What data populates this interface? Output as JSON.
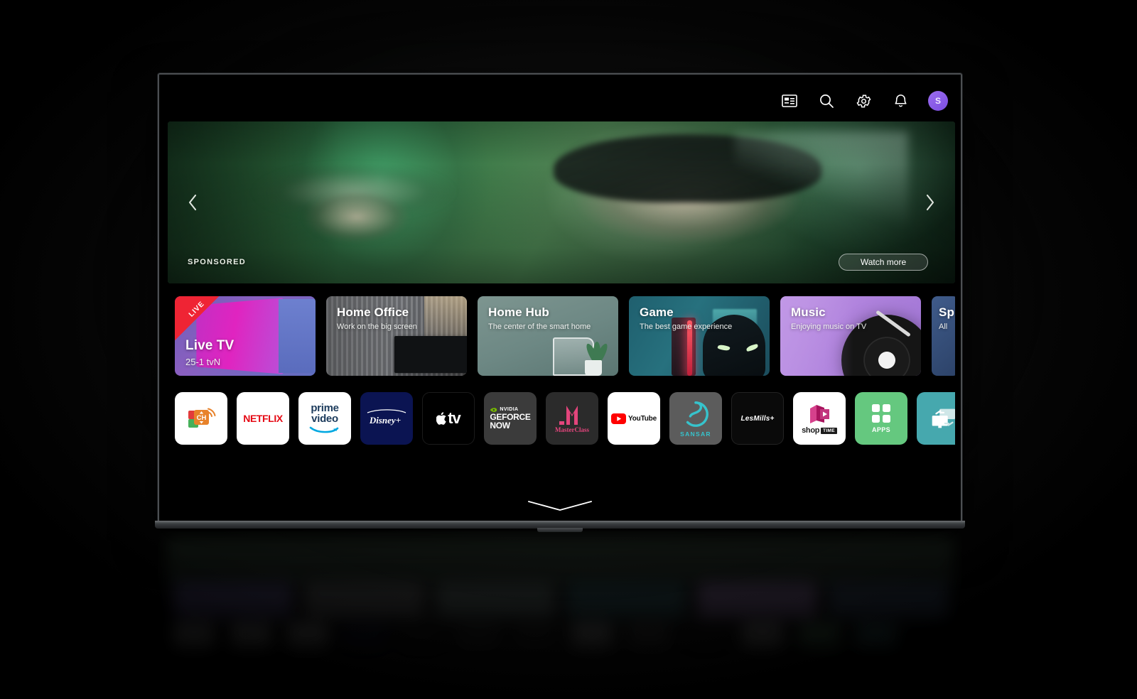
{
  "topbar": {
    "icons": [
      {
        "name": "inputs-dashboard-icon",
        "label": "Inputs"
      },
      {
        "name": "search-icon",
        "label": "Search"
      },
      {
        "name": "gear-icon",
        "label": "Settings"
      },
      {
        "name": "bell-icon",
        "label": "Notifications"
      }
    ],
    "avatar_initial": "S"
  },
  "hero": {
    "sponsored_label": "SPONSORED",
    "watch_more_label": "Watch more",
    "prev_arrow": "‹",
    "next_arrow": "›"
  },
  "cards": [
    {
      "title": "Live TV",
      "subtitle": "25-1  tvN",
      "badge": "LIVE"
    },
    {
      "title": "Home Office",
      "subtitle": "Work on the big screen",
      "badge": ""
    },
    {
      "title": "Home Hub",
      "subtitle": "The center of the smart home",
      "badge": ""
    },
    {
      "title": "Game",
      "subtitle": "The best game experience",
      "badge": ""
    },
    {
      "title": "Music",
      "subtitle": "Enjoying music on TV",
      "badge": ""
    },
    {
      "title": "Sp",
      "subtitle": "All",
      "badge": ""
    }
  ],
  "apps": [
    {
      "name": "channels",
      "label": "CH"
    },
    {
      "name": "netflix",
      "label": "NETFLIX"
    },
    {
      "name": "prime-video",
      "label_top": "prime",
      "label_bottom": "video"
    },
    {
      "name": "disney-plus",
      "label": "Disney+"
    },
    {
      "name": "apple-tv",
      "label": "tv"
    },
    {
      "name": "geforce-now",
      "brand": "NVIDIA",
      "line1": "GEFORCE",
      "line2": "NOW"
    },
    {
      "name": "masterclass",
      "label": "MasterClass"
    },
    {
      "name": "youtube",
      "label": "YouTube"
    },
    {
      "name": "sansar",
      "label": "SANSAR"
    },
    {
      "name": "lesmills",
      "label": "LesMills+"
    },
    {
      "name": "shoptime",
      "label": "shop",
      "badge": "TIME"
    },
    {
      "name": "apps",
      "label": "APPS"
    },
    {
      "name": "screen-share",
      "label": ""
    },
    {
      "name": "more-app",
      "label": ""
    }
  ],
  "colors": {
    "accent_purple": "#8a5fc0",
    "live_red": "#ef2434",
    "netflix_red": "#e50914",
    "apps_green": "#65c87f",
    "share_teal": "#46a8ae"
  }
}
